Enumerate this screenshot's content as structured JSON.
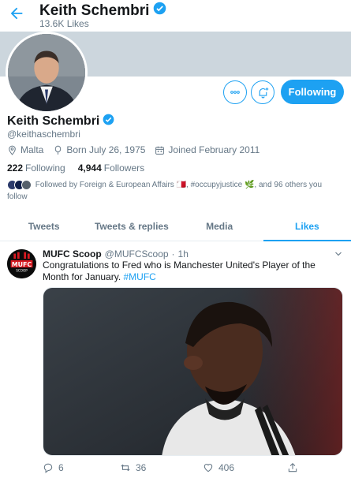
{
  "header": {
    "title": "Keith Schembri",
    "likes": "13.6K Likes"
  },
  "profile": {
    "name": "Keith Schembri",
    "handle": "@keithaschembri",
    "location": "Malta",
    "born": "Born July 26, 1975",
    "joined": "Joined February 2011",
    "following_count": "222",
    "following_label": "Following",
    "followers_count": "4,944",
    "followers_label": "Followers",
    "followed_by_text": "Followed by Foreign & European Affairs 🇲🇹, #occupyjustice 🌿, and 96 others you",
    "followed_by_cont": "follow",
    "follow_button": "Following"
  },
  "tabs": [
    "Tweets",
    "Tweets & replies",
    "Media",
    "Likes"
  ],
  "active_tab": "Likes",
  "tweet": {
    "name": "MUFC Scoop",
    "handle": "@MUFCScoop",
    "separator": "·",
    "time": "1h",
    "text": "Congratulations to Fred who is Manchester United's Player of the Month for January. ",
    "hashtag": "#MUFC",
    "avatar_text_top": "MUFC",
    "avatar_text_bottom": "SCOOP",
    "replies": "6",
    "retweets": "36",
    "likes": "406"
  },
  "colors": {
    "accent": "#1da1f2",
    "banner": "#ccd6dd",
    "muted": "#657786"
  }
}
